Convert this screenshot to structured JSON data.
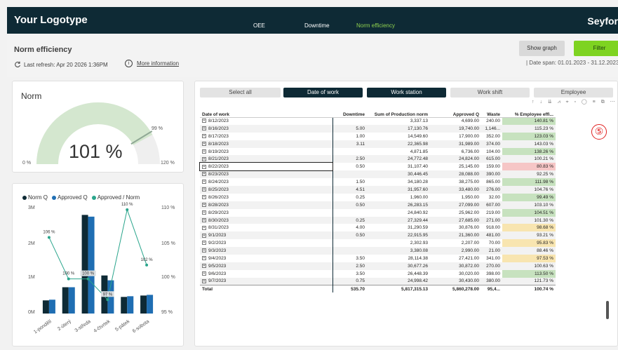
{
  "topbar": {
    "logo": "Your Logotype",
    "brand": "Seyfor",
    "nav": [
      "OEE",
      "Downtime",
      "Norm efficiency"
    ],
    "active_nav": "Norm efficiency"
  },
  "header": {
    "title": "Norm efficiency",
    "refresh_icon": "refresh-icon",
    "last_refresh": "Last refresh: Apr 20 2026 1:36PM",
    "info_icon": "info-icon",
    "info_glyph": "i",
    "more_info": "More information",
    "show_graph": "Show graph",
    "filter": "Filter",
    "date_span": "| Date span: 01.01.2023 - 31.12.2023"
  },
  "gauge": {
    "title": "Norm",
    "value_label": "101 %",
    "value": 101,
    "min_label": "0 %",
    "max_label": "120 %",
    "target_label": "99 %",
    "min": 0,
    "max": 120,
    "target": 99,
    "colors": {
      "fill": "#d4e7cf",
      "track": "#efefef",
      "target": "#8fa895"
    }
  },
  "combo_chart": {
    "legend": [
      {
        "label": "Norm Q",
        "color": "#0e2a35"
      },
      {
        "label": "Approved Q",
        "color": "#1f6eb3"
      },
      {
        "label": "Approved / Norm",
        "color": "#2aa58c"
      }
    ],
    "y_left_ticks": [
      "3M",
      "2M",
      "1M",
      "0M"
    ],
    "y_right_ticks": [
      "110 %",
      "105 %",
      "100 %",
      "95 %"
    ]
  },
  "chart_data": {
    "type": "bar",
    "categories": [
      "1-pondělí",
      "2-úterý",
      "3-středa",
      "4-čtvrtek",
      "5-pátek",
      "6-sobota"
    ],
    "series": [
      {
        "name": "Norm Q",
        "values": [
          0.38,
          0.76,
          2.85,
          1.1,
          0.48,
          0.52
        ]
      },
      {
        "name": "Approved Q",
        "values": [
          0.4,
          0.76,
          2.8,
          0.96,
          0.5,
          0.54
        ]
      },
      {
        "name": "Approved / Norm",
        "values": [
          106,
          100,
          100,
          97,
          110,
          102
        ]
      }
    ],
    "data_labels": [
      "106 %",
      "100 %",
      "100 %",
      "97 %",
      "110 %",
      "102 %"
    ],
    "ylim": [
      0,
      3
    ],
    "y2lim": [
      95,
      110
    ],
    "xlabel": "",
    "ylabel": ""
  },
  "slicers": [
    {
      "label": "Select all",
      "selected": false
    },
    {
      "label": "Date of work",
      "selected": true
    },
    {
      "label": "Work station",
      "selected": true
    },
    {
      "label": "Work shift",
      "selected": false
    },
    {
      "label": "Employee",
      "selected": false
    }
  ],
  "toolbar_glyphs": "↑ ↓ ⇊ ⩘ ⌖ ▫ ◯ ≡ ⧉ ⋯",
  "table": {
    "columns": [
      "Date of work",
      "Downtime",
      "Sum of Production norm",
      "Approved Q",
      "Waste",
      "% Employee effi..."
    ],
    "expand_glyph": "+",
    "rows": [
      [
        "8/12/2023",
        "",
        "3,337.13",
        "4,699.00",
        "240.00",
        "140.81 %",
        "g"
      ],
      [
        "8/16/2023",
        "5.00",
        "17,130.76",
        "19,740.00",
        "1,146...",
        "115.23 %",
        "g"
      ],
      [
        "8/17/2023",
        "1.00",
        "14,549.60",
        "17,900.00",
        "352.00",
        "123.03 %",
        "g"
      ],
      [
        "8/18/2023",
        "3.11",
        "22,365.98",
        "31,989.00",
        "374.00",
        "143.03 %",
        "g"
      ],
      [
        "8/19/2023",
        "",
        "4,871.85",
        "6,736.00",
        "104.00",
        "138.26 %",
        "g"
      ],
      [
        "8/21/2023",
        "2.50",
        "24,772.48",
        "24,824.00",
        "615.00",
        "100.21 %",
        "g"
      ],
      [
        "8/22/2023",
        "0.50",
        "31,107.40",
        "25,145.00",
        "159.00",
        "80.83 %",
        "r"
      ],
      [
        "8/23/2023",
        "",
        "30,446.45",
        "28,088.00",
        "390.00",
        "92.25 %",
        "y"
      ],
      [
        "8/24/2023",
        "1.50",
        "34,180.28",
        "38,275.00",
        "865.00",
        "111.98 %",
        "g"
      ],
      [
        "8/25/2023",
        "4.51",
        "31,957.60",
        "33,480.00",
        "276.00",
        "104.76 %",
        "g"
      ],
      [
        "8/26/2023",
        "0.25",
        "1,960.00",
        "1,950.00",
        "32.00",
        "99.49 %",
        "g"
      ],
      [
        "8/28/2023",
        "0.50",
        "26,283.15",
        "27,099.00",
        "607.00",
        "103.10 %",
        "g"
      ],
      [
        "8/29/2023",
        "",
        "24,840.92",
        "25,962.00",
        "219.00",
        "104.51 %",
        "g"
      ],
      [
        "8/30/2023",
        "0.25",
        "27,329.44",
        "27,685.00",
        "271.00",
        "101.30 %",
        "g"
      ],
      [
        "8/31/2023",
        "4.00",
        "31,290.59",
        "30,876.00",
        "918.00",
        "98.68 %",
        "y"
      ],
      [
        "9/1/2023",
        "0.50",
        "22,915.95",
        "21,360.00",
        "481.00",
        "93.21 %",
        "y"
      ],
      [
        "9/2/2023",
        "",
        "2,302.93",
        "2,207.00",
        "70.00",
        "95.83 %",
        "y"
      ],
      [
        "9/3/2023",
        "",
        "3,380.08",
        "2,990.00",
        "21.00",
        "88.46 %",
        "r"
      ],
      [
        "9/4/2023",
        "3.50",
        "28,114.38",
        "27,421.00",
        "341.00",
        "97.53 %",
        "y"
      ],
      [
        "9/5/2023",
        "2.50",
        "30,677.26",
        "30,872.00",
        "270.00",
        "100.63 %",
        "g"
      ],
      [
        "9/6/2023",
        "3.50",
        "26,448.39",
        "30,020.00",
        "398.00",
        "113.50 %",
        "g"
      ],
      [
        "9/7/2023",
        "0.75",
        "24,998.42",
        "30,430.00",
        "380.00",
        "121.73 %",
        "g"
      ]
    ],
    "total": [
      "Total",
      "535.70",
      "5,817,315.13",
      "5,860,278.00",
      "95,4...",
      "100.74 %"
    ]
  },
  "annotation_badge": "⑤",
  "colors": {
    "accent": "#7ed321",
    "dark": "#0e2a35",
    "mid_blue": "#1f6eb3",
    "teal": "#2aa58c"
  }
}
